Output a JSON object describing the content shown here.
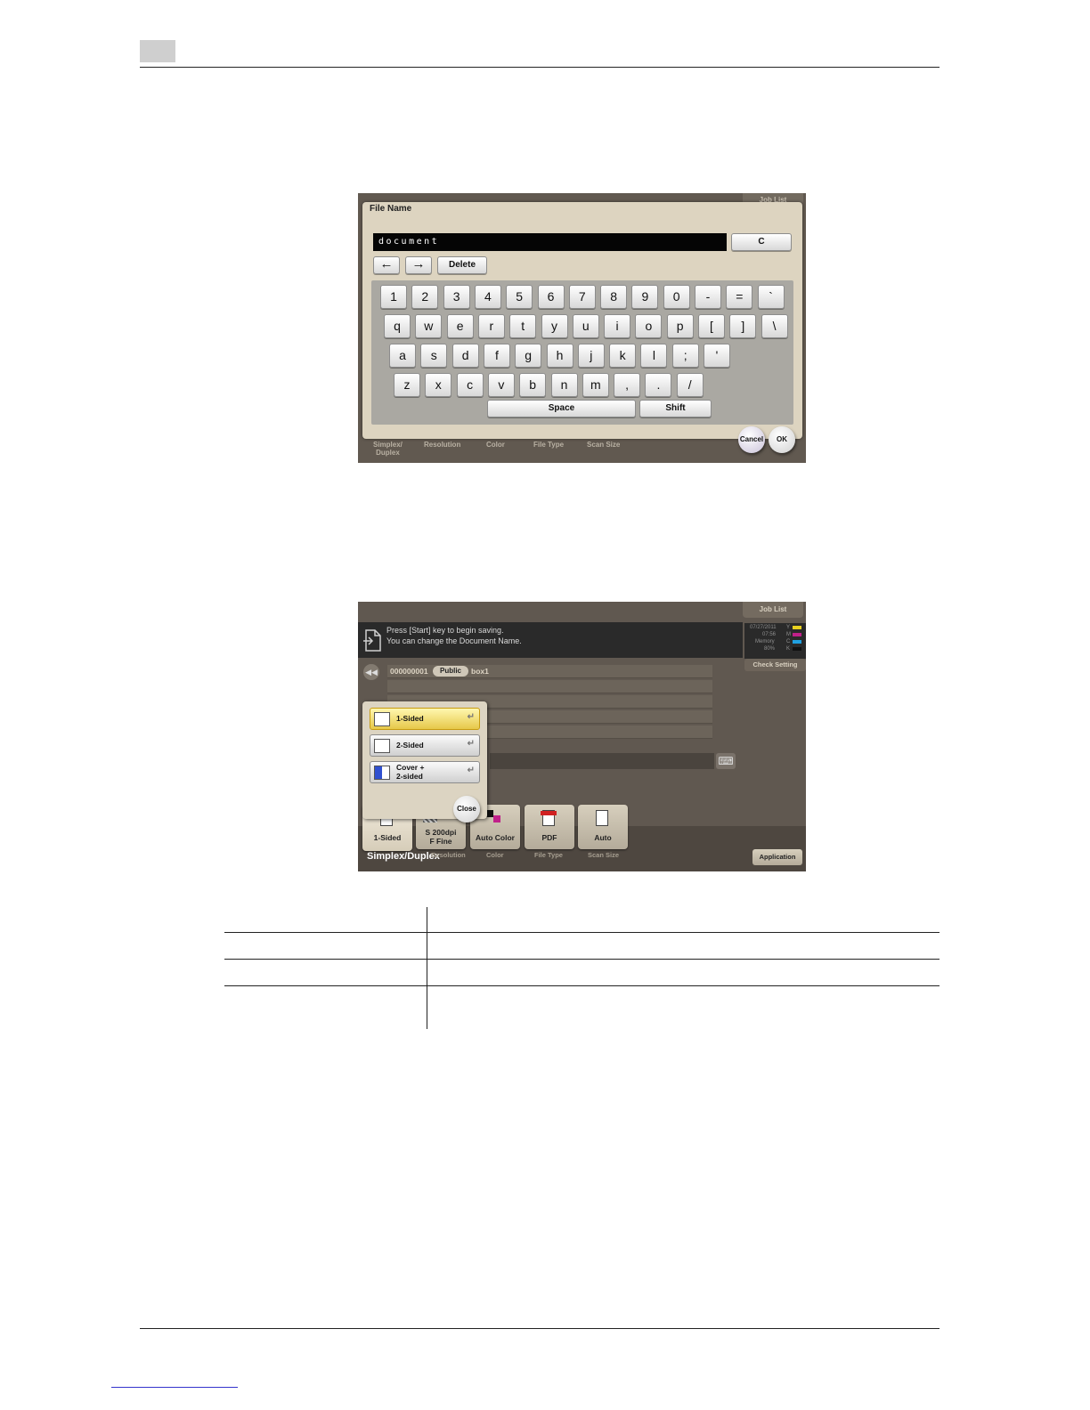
{
  "screen1": {
    "job_list_tab": "Job List",
    "dialog_title": "File Name",
    "file_name_value": "document",
    "clear_button": "C",
    "left_arrow": "←",
    "right_arrow": "→",
    "delete_button": "Delete",
    "keyboard_rows": [
      [
        "1",
        "2",
        "3",
        "4",
        "5",
        "6",
        "7",
        "8",
        "9",
        "0",
        "-",
        "=",
        "`"
      ],
      [
        "q",
        "w",
        "e",
        "r",
        "t",
        "y",
        "u",
        "i",
        "o",
        "p",
        "[",
        "]",
        "\\"
      ],
      [
        "a",
        "s",
        "d",
        "f",
        "g",
        "h",
        "j",
        "k",
        "l",
        ";",
        "'"
      ],
      [
        "z",
        "x",
        "c",
        "v",
        "b",
        "n",
        "m",
        ",",
        ".",
        "/"
      ]
    ],
    "space_key": "Space",
    "shift_key": "Shift",
    "bottom_labels": [
      "Simplex/\nDuplex",
      "Resolution",
      "Color",
      "File Type",
      "Scan Size"
    ],
    "cancel_button": "Cancel",
    "ok_button": "OK"
  },
  "screen2": {
    "job_list_tab": "Job List",
    "message_line1": "Press [Start] key to begin saving.",
    "message_line2": "You can change the Document Name.",
    "status_date": "07/27/2011",
    "status_time": "07:56",
    "status_memory_label": "Memory",
    "status_memory_value": "80%",
    "toner_labels": [
      "Y",
      "M",
      "C",
      "K"
    ],
    "check_setting_tab": "Check Setting",
    "box_number": "000000001",
    "box_type": "Public",
    "box_name": "box1",
    "options": [
      {
        "label": "1-Sided",
        "selected": true
      },
      {
        "label": "2-Sided",
        "selected": false
      },
      {
        "label": "Cover +\n2-sided",
        "selected": false
      }
    ],
    "close_button": "Close",
    "function_buttons": [
      {
        "value": "1-Sided",
        "caption": "Simplex/Duplex"
      },
      {
        "value": "S 200dpi\nF Fine",
        "caption": "Resolution"
      },
      {
        "value": "Auto Color",
        "caption": "Color"
      },
      {
        "value": "PDF",
        "caption": "File Type"
      },
      {
        "value": "Auto",
        "caption": "Scan Size"
      }
    ],
    "application_button": "Application"
  }
}
